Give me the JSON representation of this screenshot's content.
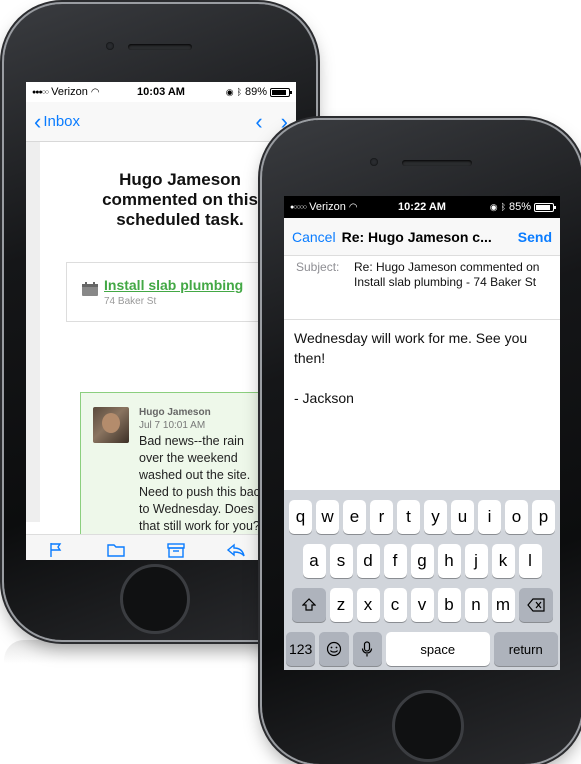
{
  "phone1": {
    "status": {
      "carrier": "Verizon",
      "time": "10:03 AM",
      "battery": "89%",
      "battery_level": 0.89
    },
    "nav": {
      "back_label": "Inbox",
      "prev_icon": "chevron-up-icon",
      "next_icon": "chevron-down-icon"
    },
    "email": {
      "headline": "Hugo Jameson commented on this scheduled task.",
      "task_title": "Install slab plumbing",
      "task_address": "74 Baker St",
      "comment": {
        "author": "Hugo Jameson",
        "date": "Jul 7  10:01 AM",
        "text": "Bad news--the rain over the weekend washed out the site. Need to push this back to Wednesday. Does that still work for you?"
      }
    },
    "toolbar": {
      "icons": [
        "flag-icon",
        "folder-icon",
        "archive-icon",
        "reply-icon"
      ]
    }
  },
  "phone2": {
    "status": {
      "carrier": "Verizon",
      "time": "10:22 AM",
      "battery": "85%",
      "battery_level": 0.85
    },
    "compose_nav": {
      "cancel_label": "Cancel",
      "title": "Re: Hugo Jameson c...",
      "send_label": "Send"
    },
    "subject": {
      "label": "Subject:",
      "value": "Re: Hugo Jameson commented on Install slab plumbing - 74 Baker St"
    },
    "body": {
      "line1": "Wednesday will work for me. See you then!",
      "line2": "",
      "line3": "- Jackson"
    },
    "keyboard": {
      "row1": [
        "q",
        "w",
        "e",
        "r",
        "t",
        "y",
        "u",
        "i",
        "o",
        "p"
      ],
      "row2": [
        "a",
        "s",
        "d",
        "f",
        "g",
        "h",
        "j",
        "k",
        "l"
      ],
      "row3": [
        "z",
        "x",
        "c",
        "v",
        "b",
        "n",
        "m"
      ],
      "numbers_label": "123",
      "space_label": "space",
      "return_label": "return"
    }
  },
  "colors": {
    "ios_blue": "#0a7cff",
    "link_green": "#43a845",
    "comment_bg": "#eef8ea",
    "comment_border": "#8bcf7e"
  }
}
